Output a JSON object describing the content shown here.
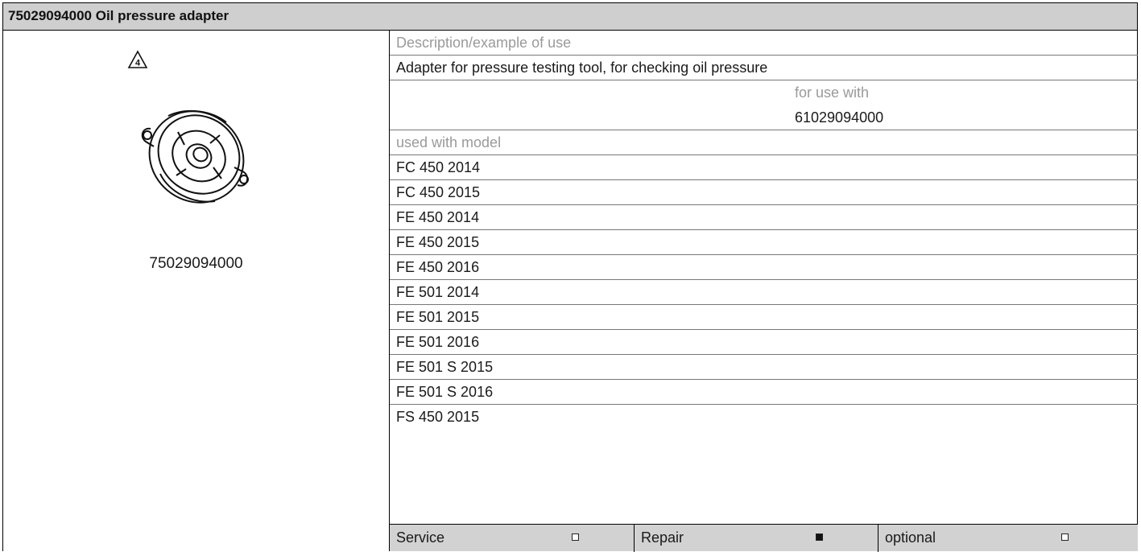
{
  "title": "75029094000 Oil pressure adapter",
  "warning_icon": {
    "name": "warning-triangle-icon",
    "number": "4"
  },
  "part_number": "75029094000",
  "description_label": "Description/example of use",
  "description": "Adapter for pressure testing tool, for checking oil pressure",
  "for_use_with_label": "for use with",
  "for_use_with_value": "61029094000",
  "used_with_model_label": "used with model",
  "models": [
    "FC 450 2014",
    "FC 450 2015",
    "FE 450 2014",
    "FE 450 2015",
    "FE 450 2016",
    "FE 501 2014",
    "FE 501 2015",
    "FE 501 2016",
    "FE 501 S 2015",
    "FE 501 S 2016",
    "FS 450 2015"
  ],
  "categories": [
    {
      "label": "Service",
      "checked": false
    },
    {
      "label": "Repair",
      "checked": true
    },
    {
      "label": "optional",
      "checked": false
    }
  ]
}
